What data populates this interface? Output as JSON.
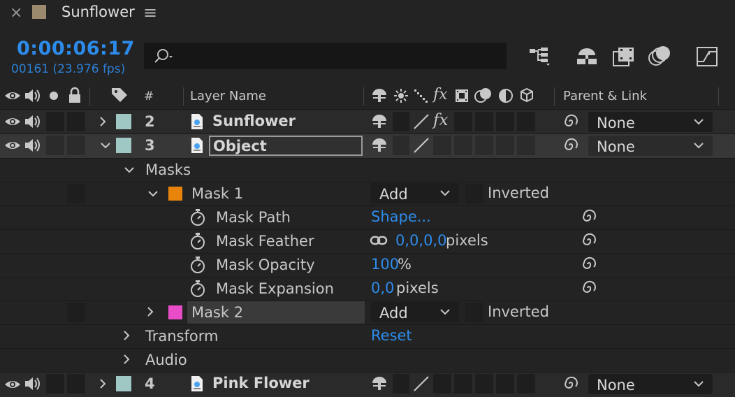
{
  "tab": {
    "close": "×",
    "title": "Sunflower",
    "menu": "≡"
  },
  "time": {
    "timecode": "0:00:06:17",
    "frames": "00161 (23.976 fps)"
  },
  "search": {
    "placeholder": ""
  },
  "columns": {
    "number": "#",
    "layer_name": "Layer Name",
    "parent_link": "Parent & Link"
  },
  "layers": [
    {
      "number": "2",
      "name": "Sunflower",
      "parent": "None",
      "label_color": "#9fc7c4"
    },
    {
      "number": "3",
      "name": "Object",
      "parent": "None",
      "label_color": "#9fc7c4"
    },
    {
      "number": "4",
      "name": "Pink Flower",
      "parent": "None",
      "label_color": "#9fc7c4"
    }
  ],
  "masks": {
    "group_label": "Masks",
    "mask1": {
      "name": "Mask 1",
      "color": "#e8840c",
      "mode": "Add",
      "inverted_label": "Inverted"
    },
    "mask2": {
      "name": "Mask 2",
      "color": "#e84cc8",
      "mode": "Add",
      "inverted_label": "Inverted"
    },
    "properties": [
      {
        "name": "Mask Path",
        "value": "Shape...",
        "unit": ""
      },
      {
        "name": "Mask Feather",
        "value": "0,0,0,0",
        "unit": "pixels"
      },
      {
        "name": "Mask Opacity",
        "value": "100",
        "unit": "%"
      },
      {
        "name": "Mask Expansion",
        "value": "0,0",
        "unit": "pixels"
      }
    ]
  },
  "transform": {
    "label": "Transform",
    "reset": "Reset"
  },
  "audio": {
    "label": "Audio"
  },
  "colors": {
    "accent": "#2d8ceb",
    "selected_row": "#373737",
    "background": "#232323"
  }
}
